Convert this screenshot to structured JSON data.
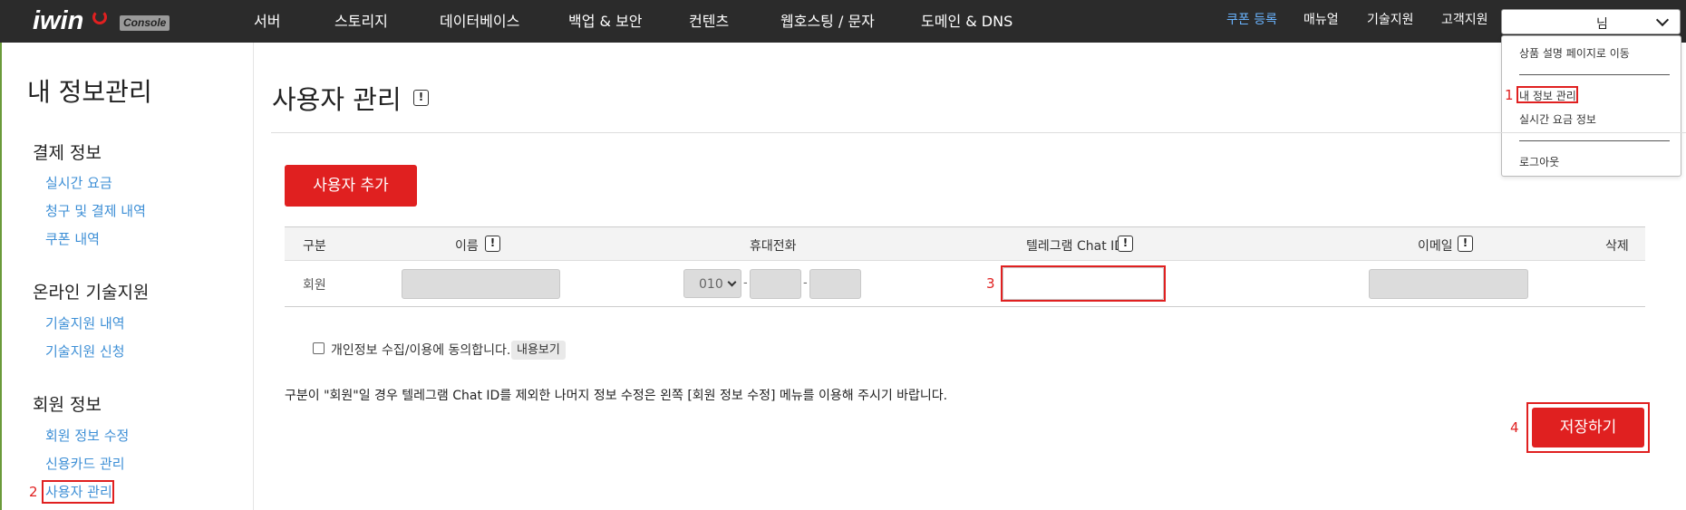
{
  "header": {
    "logo_text": "iwin",
    "logo_badge": "Console",
    "nav": [
      "서버",
      "스토리지",
      "데이터베이스",
      "백업 & 보안",
      "컨텐츠",
      "웹호스팅 / 문자",
      "도메인 & DNS"
    ],
    "util": {
      "coupon": "쿠폰 등록",
      "manual": "매뉴얼",
      "tech_support": "기술지원",
      "customer_support": "고객지원"
    },
    "user_select": "님",
    "dropdown": {
      "items": [
        "상품 설명 페이지로 이동",
        "내 정보 관리",
        "실시간 요금 정보",
        "로그아웃"
      ]
    }
  },
  "sidebar": {
    "title": "내 정보관리",
    "groups": [
      {
        "label": "결제 정보",
        "links": [
          "실시간 요금",
          "청구 및 결제 내역",
          "쿠폰 내역"
        ]
      },
      {
        "label": "온라인 기술지원",
        "links": [
          "기술지원 내역",
          "기술지원 신청"
        ]
      },
      {
        "label": "회원 정보",
        "links": [
          "회원 정보 수정",
          "신용카드 관리",
          "사용자 관리"
        ]
      }
    ]
  },
  "main": {
    "title": "사용자 관리",
    "info_mark": "!",
    "add_user_button": "사용자 추가",
    "table": {
      "headers": {
        "type": "구분",
        "name": "이름",
        "phone": "휴대전화",
        "telegram": "텔레그램 Chat ID",
        "email": "이메일",
        "delete": "삭제"
      },
      "row": {
        "type": "회원",
        "phone_prefix": "010",
        "phone_sep": "-",
        "telegram_value": ""
      }
    },
    "consent_label": "개인정보 수집/이용에 동의합니다.",
    "view_button": "내용보기",
    "notice": "구분이 \"회원\"일 경우 텔레그램 Chat ID를 제외한 나머지 정보 수정은 왼쪽 [회원 정보 수정] 메뉴를 이용해 주시기 바랍니다.",
    "save_button": "저장하기"
  },
  "annotations": {
    "step1": "1",
    "step2": "2",
    "step3": "3",
    "step4": "4",
    "highlight_color": "#e02020"
  }
}
